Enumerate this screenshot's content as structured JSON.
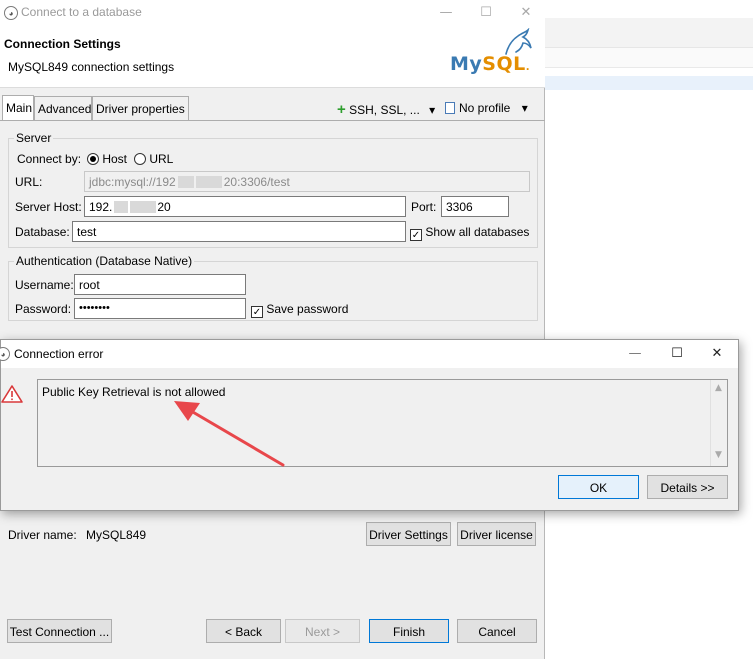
{
  "main_dialog": {
    "title": "Connect to a database",
    "header_title": "Connection Settings",
    "header_subtitle": "MySQL849 connection settings",
    "logo": {
      "text_blue": "My",
      "text_orange": "SQL",
      "suffix": "."
    },
    "window_controls": {
      "minimize": "—",
      "maximize": "☐",
      "close": "✕"
    }
  },
  "tabs": [
    {
      "label": "Main",
      "active": true
    },
    {
      "label": "Advanced",
      "active": false
    },
    {
      "label": "Driver properties",
      "active": false
    }
  ],
  "toolbar": {
    "ssh_label": "SSH, SSL, ...",
    "profile_label": "No profile",
    "dropdown_glyph": "▾"
  },
  "server": {
    "group_label": "Server",
    "connect_by_label": "Connect by:",
    "host_option": "Host",
    "url_option": "URL",
    "url_label": "URL:",
    "url_value_start": "jdbc:mysql://192",
    "url_value_end": "20:3306/test",
    "host_label": "Server Host:",
    "host_value_start": "192.",
    "host_value_end": "20",
    "port_label": "Port:",
    "port_value": "3306",
    "database_label": "Database:",
    "database_value": "test",
    "show_all_label": "Show all databases"
  },
  "auth": {
    "group_label": "Authentication (Database Native)",
    "username_label": "Username:",
    "username_value": "root",
    "password_label": "Password:",
    "password_value": "••••••••",
    "save_password_label": "Save password"
  },
  "driver": {
    "name_label": "Driver name:",
    "name_value": "MySQL849",
    "settings_button": "Driver Settings",
    "license_button": "Driver license"
  },
  "footer": {
    "test_button": "Test Connection ...",
    "back_button": "< Back",
    "next_button": "Next >",
    "finish_button": "Finish",
    "cancel_button": "Cancel"
  },
  "error_dialog": {
    "title": "Connection error",
    "message": "Public Key Retrieval is not allowed",
    "ok_button": "OK",
    "details_button": "Details >>",
    "window_controls": {
      "minimize": "—",
      "maximize": "☐",
      "close": "✕"
    }
  },
  "colors": {
    "accent": "#0078d7",
    "mysql_blue": "#3a7ab2",
    "mysql_orange": "#e48e00",
    "annotation_arrow": "#e8474b",
    "warning_icon": "#d9383a"
  }
}
